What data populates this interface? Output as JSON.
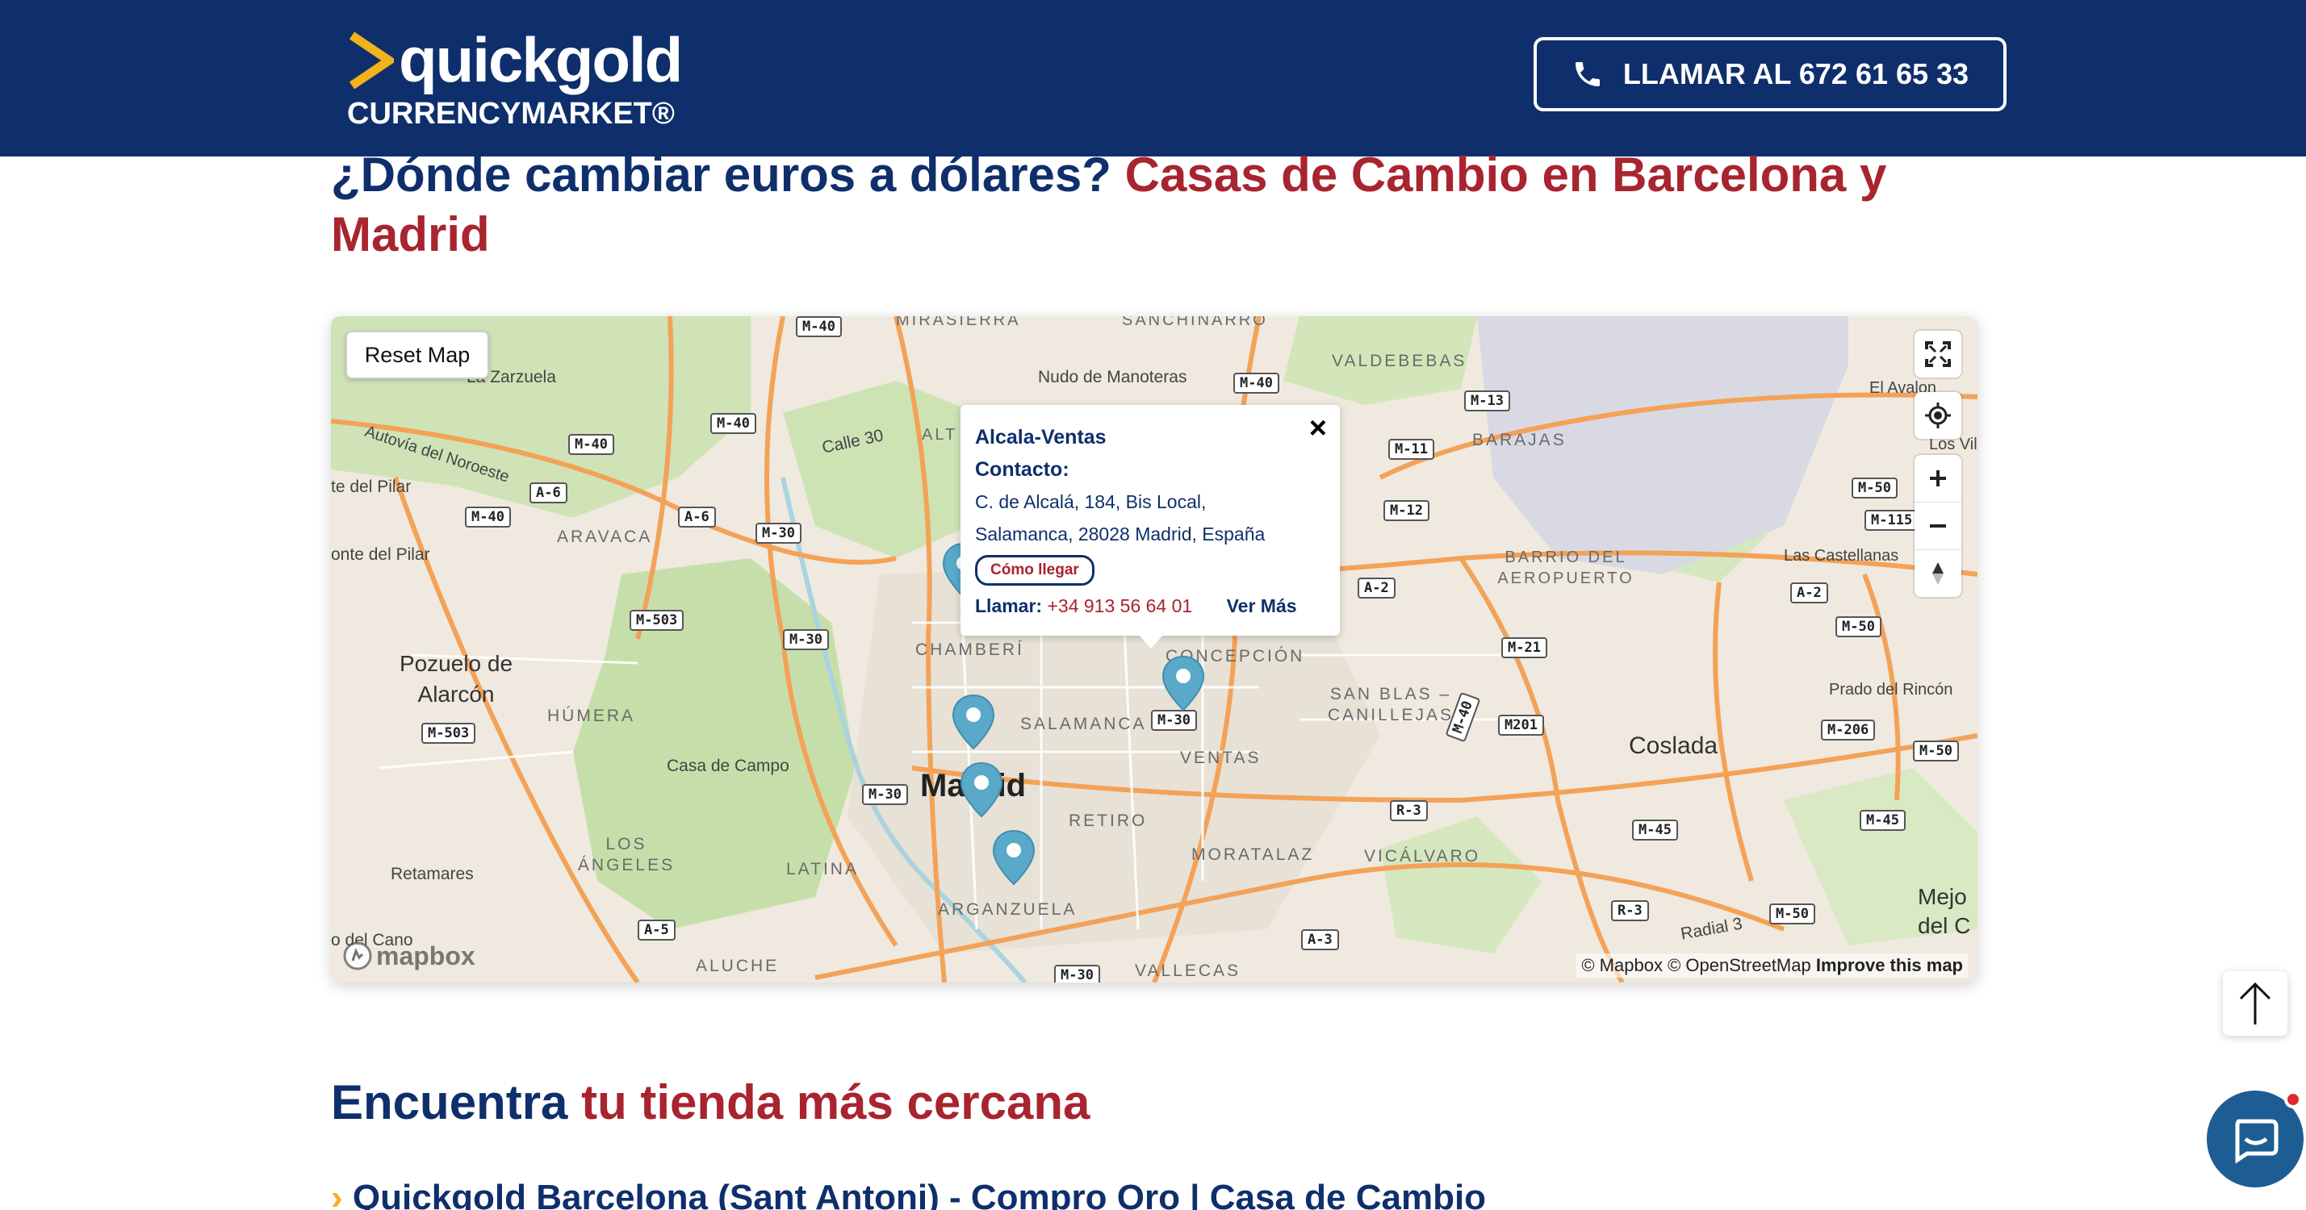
{
  "header": {
    "brand": "quickgold",
    "brand_sub": "CURRENCYMARKET®",
    "call_button": "LLAMAR AL 672 61 65 33",
    "bg_color": "#0f2f6c",
    "accent_color": "#f2b21c"
  },
  "title": {
    "part1": "¿Dónde cambiar euros a dólares?",
    "part2": "Casas de Cambio en Barcelona y Madrid"
  },
  "map": {
    "reset_button": "Reset Map",
    "controls": [
      "fullscreen-icon",
      "geolocate-icon",
      "zoom-in-icon",
      "zoom-out-icon",
      "compass-icon"
    ],
    "labels": {
      "mirasierra": "MIRASIERRA",
      "sanchinarro": "SANCHINARRO",
      "valdebebas": "VALDEBEBAS",
      "el_avalon": "El Avalon",
      "la_zarzuela": "La Zarzuela",
      "nudo": "Nudo de Manoteras",
      "barajas": "BARAJAS",
      "autovia": "Autovía del Noroeste",
      "los_vil": "Los Vil",
      "te_del_pilar": "te del Pilar",
      "calle30": "Calle 30",
      "alt": "ALT",
      "aravaca": "ARAVACA",
      "barrio_aeropuerto": "BARRIO DEL AEROPUERTO",
      "las_castellanas": "Las Castellanas",
      "onte_del_pilar": "onte del Pilar",
      "chamberi": "CHAMBERÍ",
      "concepcion": "CONCEPCIÓN",
      "pozuelo": "Pozuelo de Alarcón",
      "san_blas": "SAN BLAS – CANILLEJAS",
      "prado": "Prado del Rincón",
      "humera": "HÚMERA",
      "salamanca": "SALAMANCA",
      "casa_de_campo": "Casa de Campo",
      "ventas": "VENTAS",
      "coslada": "Coslada",
      "madrid": "Madrid",
      "retiro": "RETIRO",
      "los_angeles": "LOS ÁNGELES",
      "moratalaz": "MORATALAZ",
      "vicalvaro": "VICÁLVARO",
      "retamares": "Retamares",
      "latina": "LATINA",
      "mejo": "Mejo del C",
      "arganzuela": "ARGANZUELA",
      "radial3": "Radial 3",
      "o_del_cano": "o del Cano",
      "aluche": "ALUCHE",
      "vallecas": "VALLECAS"
    },
    "road_shields": [
      "M-40",
      "M-40",
      "M-40",
      "M-40",
      "M-40",
      "A-6",
      "A-6",
      "M-30",
      "M-503",
      "M-30",
      "M-503",
      "M-30",
      "M-30",
      "M-13",
      "M-11",
      "M-12",
      "A-2",
      "A-2",
      "M-50",
      "M-115",
      "M-50",
      "M-21",
      "M201",
      "M-206",
      "M-50",
      "R-3",
      "M-45",
      "M-45",
      "A-5",
      "A-3",
      "M-30",
      "R-3",
      "M-50",
      "M-40"
    ],
    "popup": {
      "name": "Alcala-Ventas",
      "contact_label": "Contacto:",
      "address_line1": "C. de Alcalá, 184, Bis Local,",
      "address_line2": "Salamanca, 28028 Madrid, España",
      "directions_button": "Cómo llegar",
      "call_label": "Llamar:",
      "phone": "+34 913 56 64 01",
      "more_link": "Ver Más",
      "close": "×"
    },
    "mapbox_logo": "mapbox",
    "attribution_mapbox": "© Mapbox",
    "attribution_osm": "© OpenStreetMap",
    "improve_link": "Improve this map",
    "pin_color": "#5aa9c9"
  },
  "section": {
    "title_part1": "Encuentra",
    "title_part2": "tu tienda más cercana",
    "first_item": "Quickgold Barcelona (Sant Antoni) - Compro Oro | Casa de Cambio"
  },
  "floating": {
    "scroll_top": "arrow-up-icon",
    "chat": "chat-icon"
  }
}
